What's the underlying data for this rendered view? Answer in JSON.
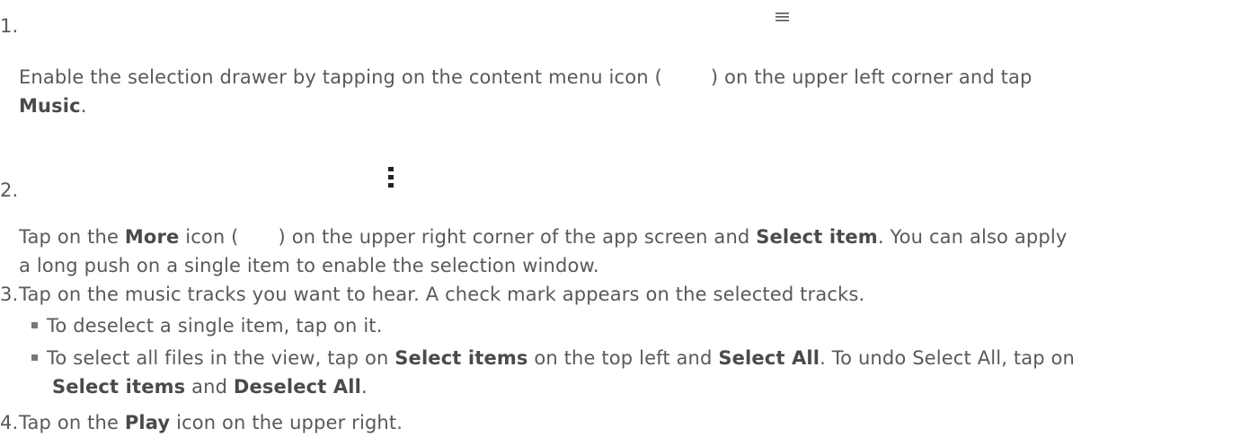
{
  "steps": [
    {
      "number": "1.",
      "icon": "hamburger-menu-icon",
      "p1": "Enable the selection drawer by tapping on the content menu icon (",
      "p2": ") on the upper left corner and tap",
      "bold1": "Music",
      "p3": "."
    },
    {
      "number": "2.",
      "icon": "more-vertical-icon",
      "p1": "Tap on the ",
      "bold1": "More",
      "p2": " icon (",
      "p3": ") on the upper right corner of the app screen and ",
      "bold2": "Select item",
      "p4": ". You can also apply",
      "p5": "a long push on a single item to enable the selection window."
    },
    {
      "number": "3.",
      "text": "Tap on the music tracks you want to hear. A check mark appears on the selected tracks.",
      "bullets": [
        {
          "text": "To deselect a single item, tap on it."
        },
        {
          "p1": "To select all files in the view, tap on ",
          "bold1": "Select items",
          "p2": " on the top left and ",
          "bold2": "Select All",
          "p3": ". To undo Select All, tap on",
          "bold3": "Select items",
          "p4": " and ",
          "bold4": "Deselect All",
          "p5": "."
        }
      ]
    },
    {
      "number": "4.",
      "p1": "Tap on the ",
      "bold1": "Play",
      "p2": " icon on the upper right."
    }
  ]
}
